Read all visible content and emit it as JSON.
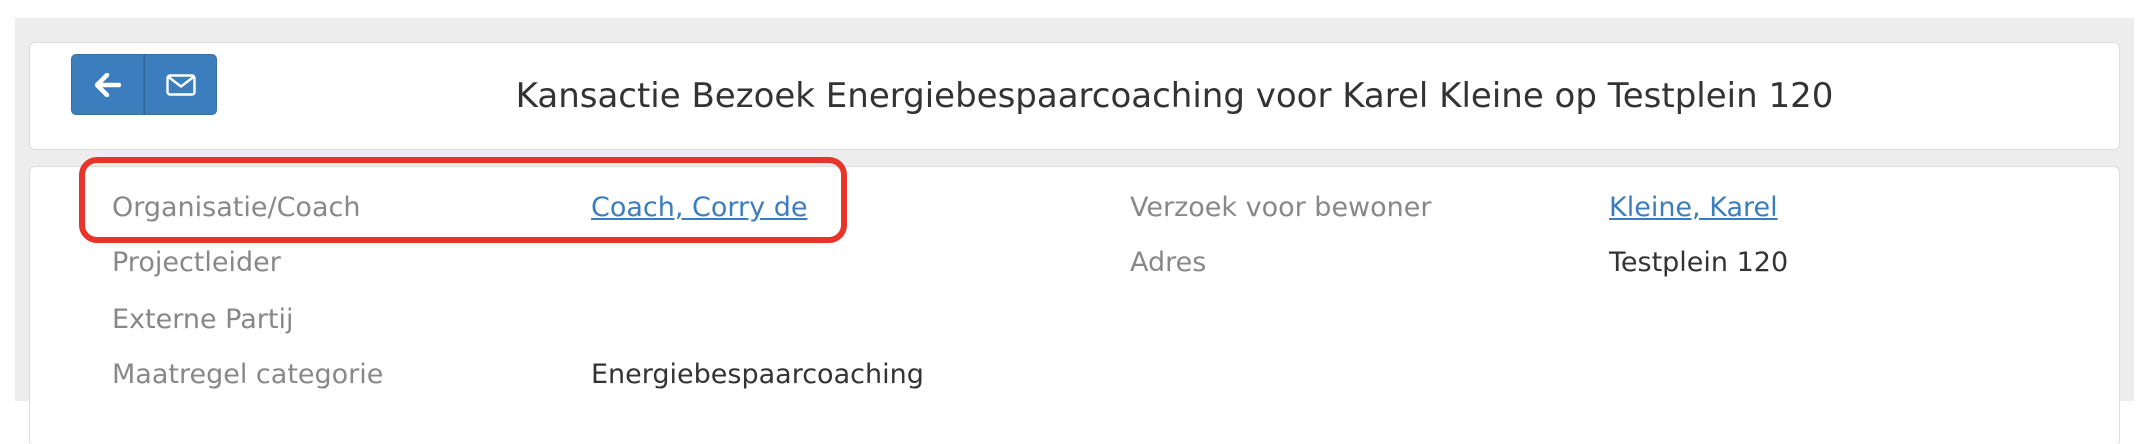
{
  "header": {
    "title": "Kansactie Bezoek Energiebespaarcoaching voor Karel Kleine op Testplein 120",
    "back_icon": "arrow-left-icon",
    "mail_icon": "envelope-icon"
  },
  "details": {
    "organisatie_label": "Organisatie/Coach",
    "organisatie_value": "Coach, Corry de",
    "projectleider_label": "Projectleider",
    "externe_partij_label": "Externe Partij",
    "maatregel_label": "Maatregel categorie",
    "maatregel_value": "Energiebespaarcoaching",
    "verzoek_label": "Verzoek voor bewoner",
    "verzoek_value": "Kleine, Karel",
    "adres_label": "Adres",
    "adres_value": "Testplein 120"
  },
  "colors": {
    "button": "#3c7ebd",
    "link": "#3c7ebd",
    "highlight": "#e8352b"
  }
}
